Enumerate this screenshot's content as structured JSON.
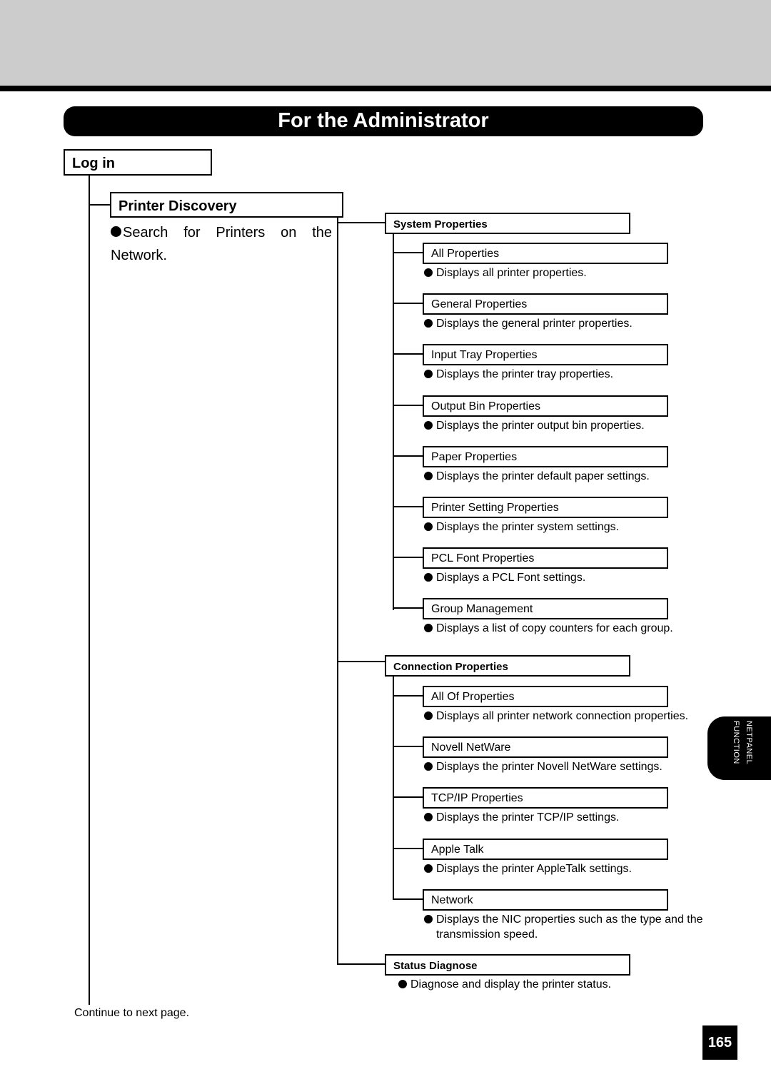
{
  "header": {
    "title": "For the Administrator"
  },
  "login": {
    "label": "Log in"
  },
  "printer_discovery": {
    "label": "Printer Discovery",
    "description": "Search for Printers on the Network."
  },
  "system_properties": {
    "label": "System Properties",
    "items": [
      {
        "label": "All Properties",
        "desc": "Displays all printer properties."
      },
      {
        "label": "General Properties",
        "desc": "Displays the general printer properties."
      },
      {
        "label": "Input Tray Properties",
        "desc": "Displays the printer tray properties."
      },
      {
        "label": "Output Bin Properties",
        "desc": "Displays the printer output bin properties."
      },
      {
        "label": "Paper Properties",
        "desc": "Displays the printer default paper settings."
      },
      {
        "label": "Printer Setting Properties",
        "desc": "Displays the printer system settings."
      },
      {
        "label": "PCL Font Properties",
        "desc": "Displays a PCL Font settings."
      },
      {
        "label": "Group Management",
        "desc": "Displays a list of copy counters for each group."
      }
    ]
  },
  "connection_properties": {
    "label": "Connection Properties",
    "items": [
      {
        "label": "All Of Properties",
        "desc": "Displays all printer network connection properties."
      },
      {
        "label": "Novell NetWare",
        "desc": "Displays the printer Novell NetWare settings."
      },
      {
        "label": "TCP/IP Properties",
        "desc": "Displays the printer TCP/IP settings."
      },
      {
        "label": "Apple Talk",
        "desc": "Displays the printer AppleTalk settings."
      },
      {
        "label": "Network",
        "desc": "Displays the NIC properties such as the type and the transmission speed."
      }
    ]
  },
  "status_diagnose": {
    "label": "Status Diagnose",
    "desc": "Diagnose and display the printer status."
  },
  "footer": {
    "continue": "Continue to next page.",
    "page_number": "165",
    "side_tab": {
      "line1": "NETPANEL",
      "line2": "FUNCTION"
    }
  }
}
